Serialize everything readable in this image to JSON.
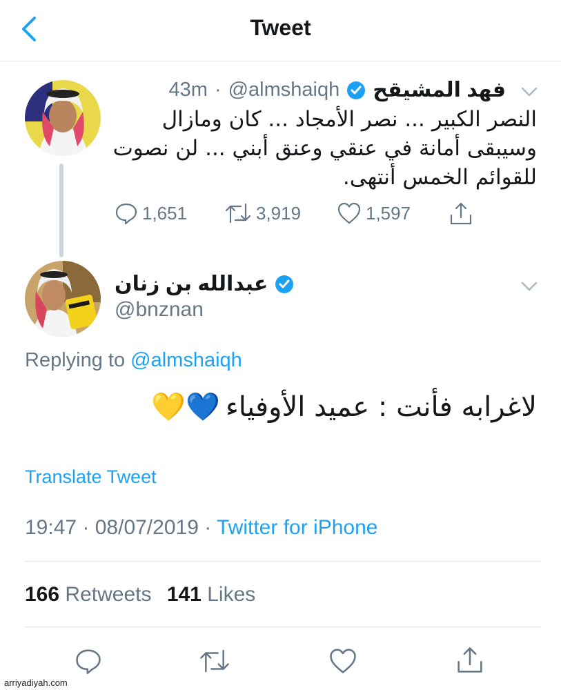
{
  "header": {
    "title": "Tweet"
  },
  "parent_tweet": {
    "name": "فهد المشيقح",
    "handle": "@almshaiqh",
    "separator": "·",
    "time": "43m",
    "lines": [
      "النصر الكبير ...  نصر الأمجاد ... كان ومازال",
      "وسيبقى أمانة في عنقي وعنق أبني ... لن نصوت",
      "للقوائم  الخمس أنتهى."
    ],
    "replies": "1,651",
    "retweets": "3,919",
    "likes": "1,597"
  },
  "main_tweet": {
    "name": "عبدالله بن زنان",
    "handle": "@bnznan",
    "replying_prefix": "Replying to",
    "replying_handle": "@almshaiqh",
    "text": "لاغرابه فأنت : عميد الأوفياء",
    "emoji": "💛💙",
    "translate": "Translate Tweet",
    "timestamp": "19:47 · 08/07/2019 ·",
    "source": "Twitter for iPhone",
    "retweet_count": "166",
    "retweet_label": "Retweets",
    "like_count": "141",
    "like_label": "Likes"
  },
  "watermark": "arriyadiyah.com",
  "icons": [
    "back-chevron-icon",
    "verified-badge-icon",
    "chevron-down-icon",
    "reply-icon",
    "retweet-icon",
    "like-icon",
    "share-icon"
  ],
  "colors": {
    "twitter_blue": "#1da1f2",
    "gray": "#657786",
    "divider": "#e1e8ed"
  }
}
